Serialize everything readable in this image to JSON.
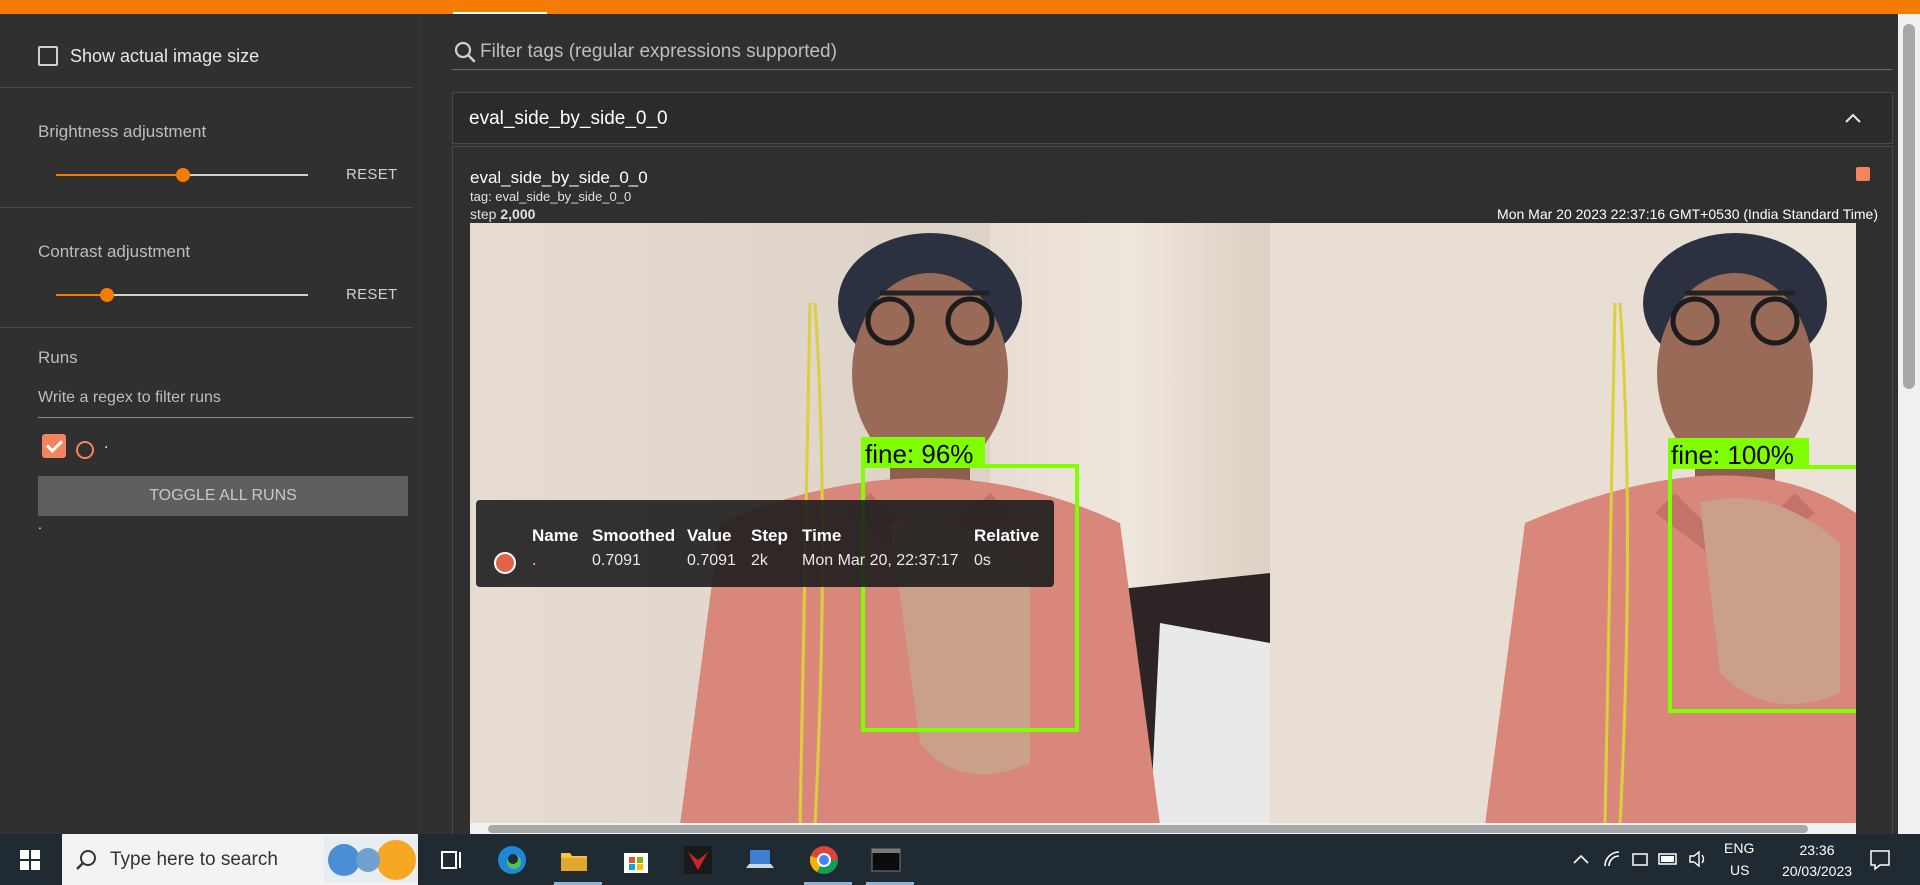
{
  "sidebar": {
    "show_actual_size": "Show actual image size",
    "brightness": {
      "label": "Brightness adjustment",
      "reset": "RESET",
      "level": 0.5
    },
    "contrast": {
      "label": "Contrast adjustment",
      "reset": "RESET",
      "level": 0.2
    },
    "runs": {
      "title": "Runs",
      "filter_placeholder": "Write a regex to filter runs",
      "run_name": ".",
      "toggle_all": "TOGGLE ALL RUNS",
      "footer": "."
    }
  },
  "search": {
    "placeholder": "Filter tags (regular expressions supported)"
  },
  "group": {
    "title": "eval_side_by_side_0_0"
  },
  "card": {
    "title": "eval_side_by_side_0_0",
    "tag": "tag: eval_side_by_side_0_0",
    "step_label": "step ",
    "step_value": "2,000",
    "timestamp": "Mon Mar 20 2023 22:37:16 GMT+0530 (India Standard Time)",
    "detections": [
      {
        "label": "fine: 96%"
      },
      {
        "label": "fine: 100%"
      }
    ]
  },
  "tooltip": {
    "headers": [
      "Name",
      "Smoothed",
      "Value",
      "Step",
      "Time",
      "Relative"
    ],
    "row": [
      ".",
      "0.7091",
      "0.7091",
      "2k",
      "Mon Mar 20, 22:37:17",
      "0s"
    ]
  },
  "taskbar": {
    "search_placeholder": "Type here to search",
    "lang": "ENG",
    "region": "US",
    "time": "23:36",
    "date": "20/03/2023"
  },
  "colors": {
    "accent": "#f57c00",
    "run": "#f4845f",
    "box": "#7fff00"
  }
}
